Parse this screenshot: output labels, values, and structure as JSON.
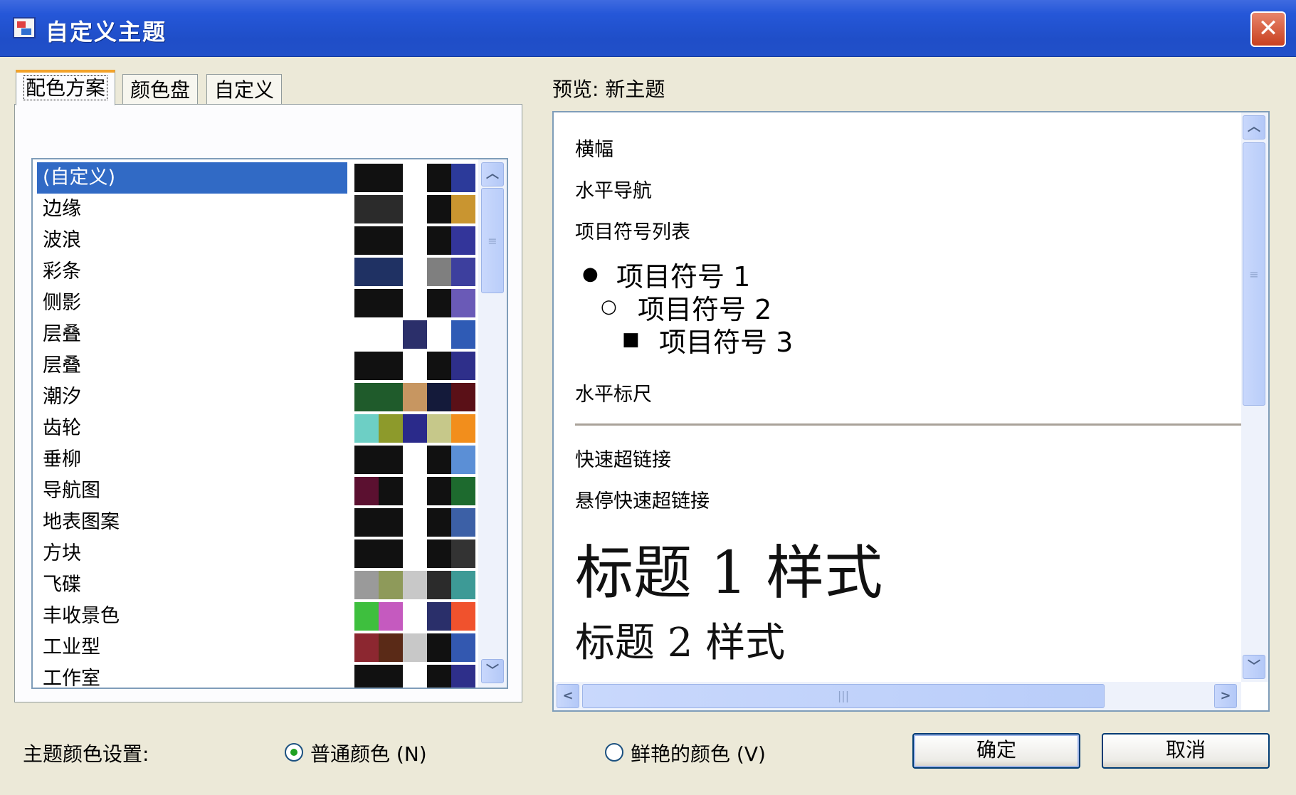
{
  "window": {
    "title": "自定义主题",
    "close_glyph": "✕"
  },
  "tabs": [
    {
      "label": "配色方案",
      "active": true
    },
    {
      "label": "颜色盘",
      "active": false
    },
    {
      "label": "自定义",
      "active": false
    }
  ],
  "schemes": [
    {
      "name": "(自定义)",
      "selected": true,
      "swatches": [
        "#111111",
        "#111111",
        null,
        "#111111",
        "#2c3a9a"
      ]
    },
    {
      "name": "边缘",
      "swatches": [
        "#2b2b2b",
        "#2b2b2b",
        null,
        "#111111",
        "#c99530"
      ]
    },
    {
      "name": "波浪",
      "swatches": [
        "#111111",
        "#111111",
        null,
        "#111111",
        "#33359a"
      ]
    },
    {
      "name": "彩条",
      "swatches": [
        "#1f3163",
        "#1f3163",
        null,
        "#7f7f7f",
        "#3d3f9e"
      ]
    },
    {
      "name": "侧影",
      "swatches": [
        "#111111",
        "#111111",
        null,
        "#111111",
        "#6a5ab7"
      ]
    },
    {
      "name": "层叠",
      "swatches": [
        null,
        null,
        "#2b2f6a",
        null,
        "#2f5bb5"
      ]
    },
    {
      "name": "层叠",
      "swatches": [
        "#111111",
        "#111111",
        null,
        "#111111",
        "#2e2f8a"
      ]
    },
    {
      "name": "潮汐",
      "swatches": [
        "#1f5b2b",
        "#1f5b2b",
        "#c79661",
        "#141a3a",
        "#5a1017"
      ]
    },
    {
      "name": "齿轮",
      "swatches": [
        "#6dcfc5",
        "#8d9a2b",
        "#2a2a8a",
        "#c6c88a",
        "#f28e1c"
      ]
    },
    {
      "name": "垂柳",
      "swatches": [
        "#111111",
        "#111111",
        null,
        "#111111",
        "#5b8fd6"
      ]
    },
    {
      "name": "导航图",
      "swatches": [
        "#5b1030",
        "#111111",
        null,
        "#111111",
        "#1d6a2e"
      ]
    },
    {
      "name": "地表图案",
      "swatches": [
        "#111111",
        "#111111",
        null,
        "#111111",
        "#3c60a6"
      ]
    },
    {
      "name": "方块",
      "swatches": [
        "#111111",
        "#111111",
        null,
        "#111111",
        "#333333"
      ]
    },
    {
      "name": "飞碟",
      "swatches": [
        "#9a9a9a",
        "#8e9a5a",
        "#c8c8c8",
        "#2b2b2b",
        "#3d9a96"
      ]
    },
    {
      "name": "丰收景色",
      "swatches": [
        "#3ebf3e",
        "#c55abf",
        null,
        "#2a2f6a",
        "#f0522d"
      ]
    },
    {
      "name": "工业型",
      "swatches": [
        "#8c2730",
        "#5a2a17",
        "#c8c8c8",
        "#111111",
        "#3358b0"
      ]
    },
    {
      "name": "工作室",
      "swatches": [
        "#111111",
        "#111111",
        null,
        "#111111",
        "#2e2f8a"
      ]
    }
  ],
  "preview": {
    "label": "预览:  新主题",
    "banner": "横幅",
    "horizontal_nav": "水平导航",
    "bullet_list": "项目符号列表",
    "bullets": [
      {
        "glyph": "●",
        "text": "项目符号 1"
      },
      {
        "glyph": "○",
        "text": "项目符号 2"
      },
      {
        "glyph": "■",
        "text": "项目符号 3"
      }
    ],
    "horizontal_rule": "水平标尺",
    "quick_link": "快速超链接",
    "hover_quick_link": "悬停快速超链接",
    "heading1_style": "标题 1 样式",
    "heading2_style": "标题 2 样式"
  },
  "bottom": {
    "theme_color_label": "主题颜色设置:",
    "normal_color": "普通颜色 (N)",
    "vivid_color": "鲜艳的颜色 (V)",
    "selected_option": "normal",
    "ok_button": "确定",
    "cancel_button": "取消"
  },
  "scroll_glyphs": {
    "up": "︿",
    "down": "﹀",
    "left": "<",
    "right": ">",
    "grip_v": "≡",
    "grip_h": "|||"
  }
}
